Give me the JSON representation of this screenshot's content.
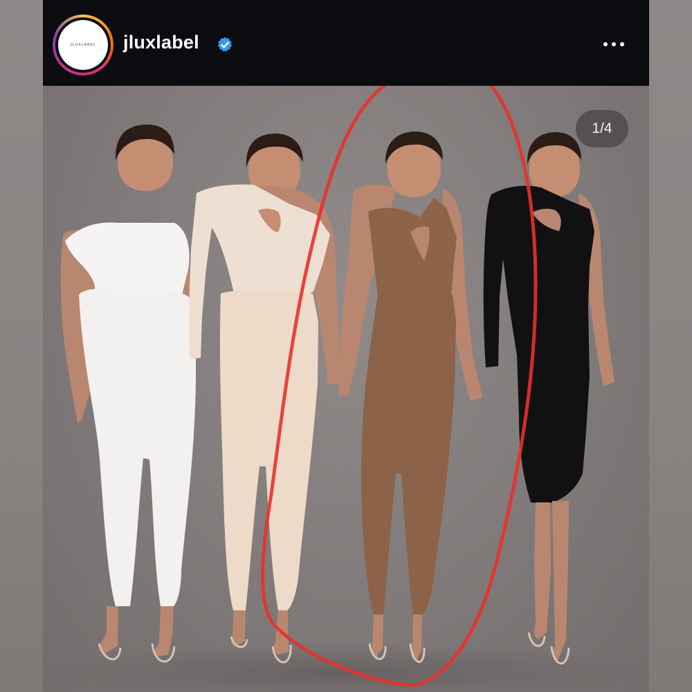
{
  "header": {
    "username": "jluxlabel",
    "avatar_text": "JLUXLABEL",
    "verified_icon": "verified-badge-icon",
    "more_icon": "more-options-icon"
  },
  "post": {
    "image_counter": "1/4",
    "outfit_colors": [
      "#f3f1ef",
      "#eedac8",
      "#8c6248",
      "#101010"
    ],
    "annotation_color": "#e8312d"
  }
}
